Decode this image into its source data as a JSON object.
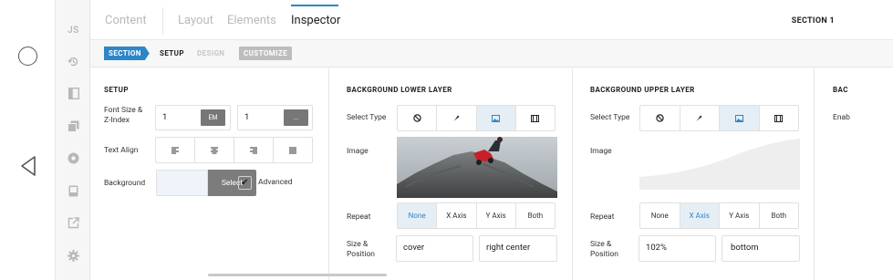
{
  "sidebar": {
    "js_label": "JS"
  },
  "tabs": {
    "content": "Content",
    "layout": "Layout",
    "elements": "Elements",
    "inspector": "Inspector"
  },
  "header_right": "SECTION 1",
  "subtabs": {
    "section": "SECTION",
    "setup": "SETUP",
    "design": "DESIGN",
    "customize": "CUSTOMIZE"
  },
  "setup": {
    "title": "SETUP",
    "font_size_label": "Font Size & Z-Index",
    "font_size_value": "1",
    "font_size_unit": "EM",
    "z_index_value": "1",
    "z_index_unit": "...",
    "text_align_label": "Text Align",
    "background_label": "Background",
    "select_label": "Select",
    "advanced_label": "Advanced",
    "advanced_checked": true
  },
  "lower": {
    "title": "BACKGROUND LOWER LAYER",
    "select_type_label": "Select Type",
    "image_label": "Image",
    "repeat_label": "Repeat",
    "repeat_options": [
      "None",
      "X Axis",
      "Y Axis",
      "Both"
    ],
    "repeat_selected": "None",
    "size_label": "Size & Position",
    "size_value": "cover",
    "position_value": "right center"
  },
  "upper": {
    "title": "BACKGROUND UPPER LAYER",
    "select_type_label": "Select Type",
    "image_label": "Image",
    "repeat_label": "Repeat",
    "repeat_options": [
      "None",
      "X Axis",
      "Y Axis",
      "Both"
    ],
    "repeat_selected": "X Axis",
    "size_label": "Size & Position",
    "size_value": "102%",
    "position_value": "bottom"
  },
  "partial": {
    "title": "BAC",
    "label": "Enab"
  },
  "colors": {
    "accent": "#2b87c8",
    "selected_bg": "#e6eef5",
    "button_grey": "#7c7c7c"
  }
}
